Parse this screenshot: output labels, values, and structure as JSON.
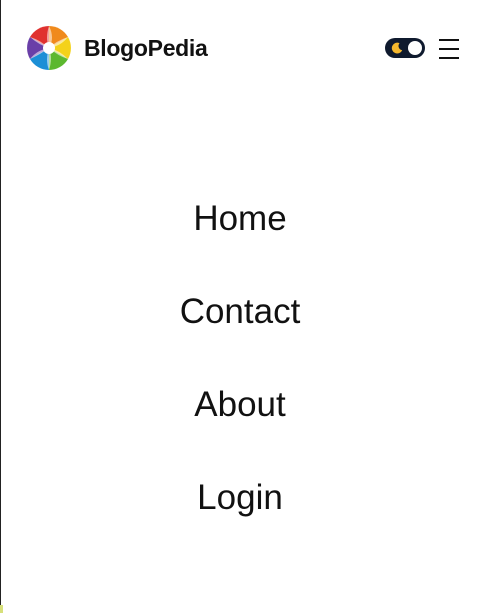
{
  "header": {
    "brand": "BlogoPedia",
    "logo_icon": "pinwheel-logo-icon",
    "theme_toggle_icon": "moon-icon",
    "menu_icon": "hamburger-menu-icon"
  },
  "nav": {
    "items": [
      {
        "label": "Home"
      },
      {
        "label": "Contact"
      },
      {
        "label": "About"
      },
      {
        "label": "Login"
      }
    ]
  },
  "colors": {
    "toggle_bg": "#0f1a2e",
    "moon": "#f5b82e",
    "text": "#111111",
    "background": "#ffffff"
  }
}
